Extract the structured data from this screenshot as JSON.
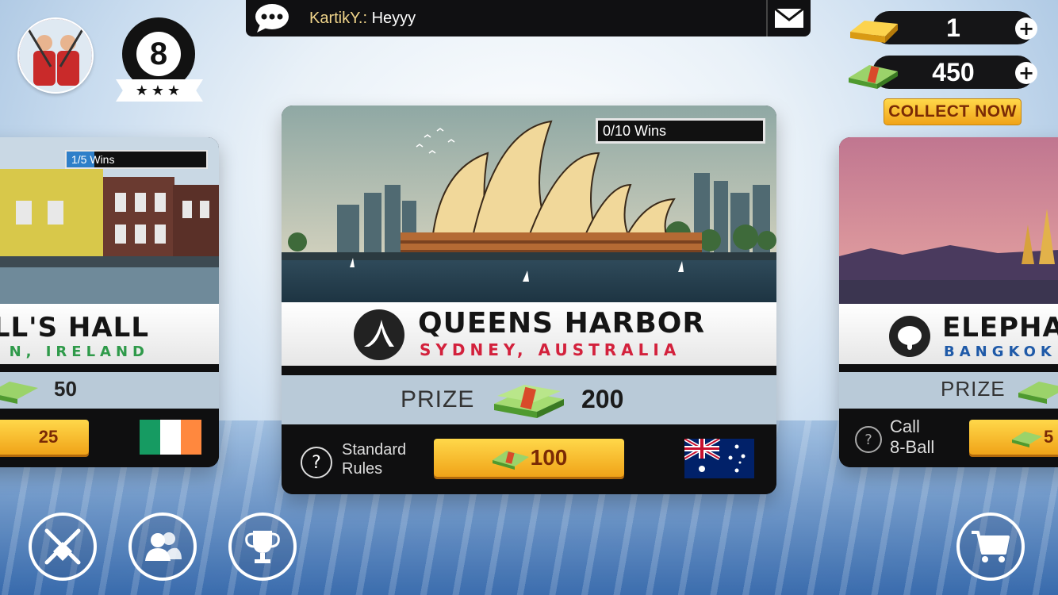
{
  "chat": {
    "username": "KartikY.:",
    "message": "Heyyy"
  },
  "player": {
    "level": "8",
    "stars": "★★★"
  },
  "currency": {
    "gold": "1",
    "cash": "450",
    "collect_label": "COLLECT NOW"
  },
  "cards": {
    "main": {
      "wins": "0/10 Wins",
      "wins_progress": 0,
      "name": "QUEENS HARBOR",
      "city": "SYDNEY, AUSTRALIA",
      "prize_label": "PRIZE",
      "prize_value": "200",
      "rules": [
        "Standard",
        "Rules"
      ],
      "entry_fee": "100",
      "flag": "australia"
    },
    "left": {
      "wins": "1/5 Wins",
      "wins_progress": 0.2,
      "name": "ILL'S HALL",
      "city": "N, IRELAND",
      "prize_value": "50",
      "entry_fee": "25",
      "flag": "ireland"
    },
    "right": {
      "name": "ELEPHA",
      "city": "BANGKOK",
      "prize_label": "PRIZE",
      "rules": [
        "Call",
        "8-Ball"
      ],
      "entry_fee": "5"
    }
  },
  "colors": {
    "gold": "#f5b623",
    "city_red": "#d3213c",
    "city_green": "#2f9a4a",
    "city_blue": "#1f5aa8"
  },
  "nav": [
    "crossed-cues-icon",
    "friends-icon",
    "trophy-icon",
    "cart-icon"
  ]
}
